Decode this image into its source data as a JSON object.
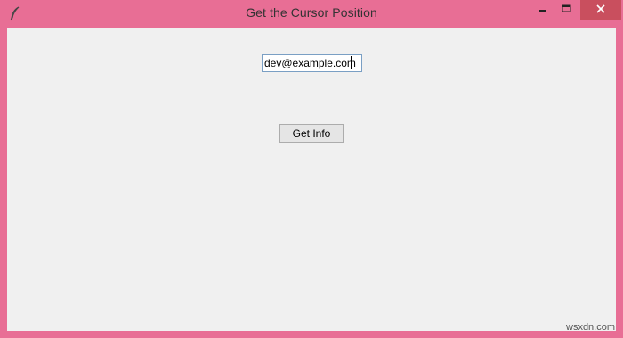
{
  "window": {
    "title": "Get the Cursor Position",
    "accent_color": "#e86e95",
    "close_color": "#c94f5e",
    "icons": {
      "app": "feather-icon",
      "minimize": "minimize-icon",
      "maximize": "maximize-icon",
      "close": "close-icon"
    }
  },
  "form": {
    "entry_value": "dev@example.com",
    "button_label": "Get Info"
  },
  "watermark": {
    "text": "wsxdn.com"
  }
}
